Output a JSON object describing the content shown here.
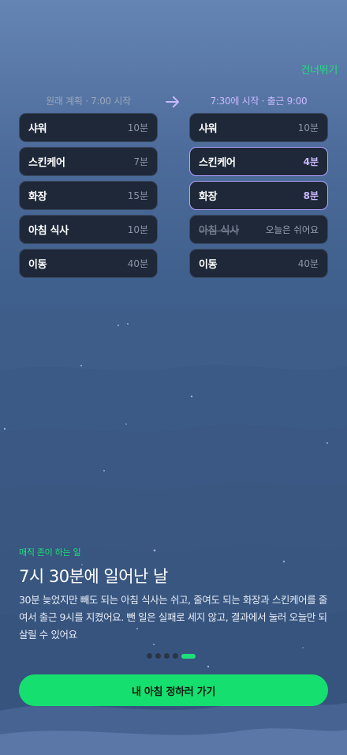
{
  "skip_label": "건너뛰기",
  "original_plan": {
    "header": "원래 계획 · 7:00 시작",
    "tasks": [
      {
        "name": "샤워",
        "duration": "10분"
      },
      {
        "name": "스킨케어",
        "duration": "7분"
      },
      {
        "name": "화장",
        "duration": "15분"
      },
      {
        "name": "아침 식사",
        "duration": "10분"
      },
      {
        "name": "이동",
        "duration": "40분"
      }
    ]
  },
  "adjusted_plan": {
    "header": "7:30에 시작 · 출근 9:00",
    "tasks": [
      {
        "name": "샤워",
        "duration": "10분"
      },
      {
        "name": "스킨케어",
        "duration": "4분"
      },
      {
        "name": "화장",
        "duration": "8분"
      },
      {
        "name": "아침 식사",
        "duration": "오늘은 쉬어요"
      },
      {
        "name": "이동",
        "duration": "40분"
      }
    ]
  },
  "eyebrow": "매직 존이 하는 일",
  "headline": "7시 30분에 일어난 날",
  "description": "30분 늦었지만 빼도 되는 아침 식사는 쉬고, 줄여도 되는 화장과 스킨케어를 줄여서 출근 9시를 지켰어요. 뺀 일은 실패로 세지 않고, 결과에서 눌러 오늘만 되살릴 수 있어요",
  "pagination": {
    "total": 5,
    "current": 5
  },
  "cta_label": "내 아침 정하러 가기",
  "colors": {
    "accent": "#1de07a",
    "highlight": "#b3a4ff",
    "card": "#1e2838"
  }
}
